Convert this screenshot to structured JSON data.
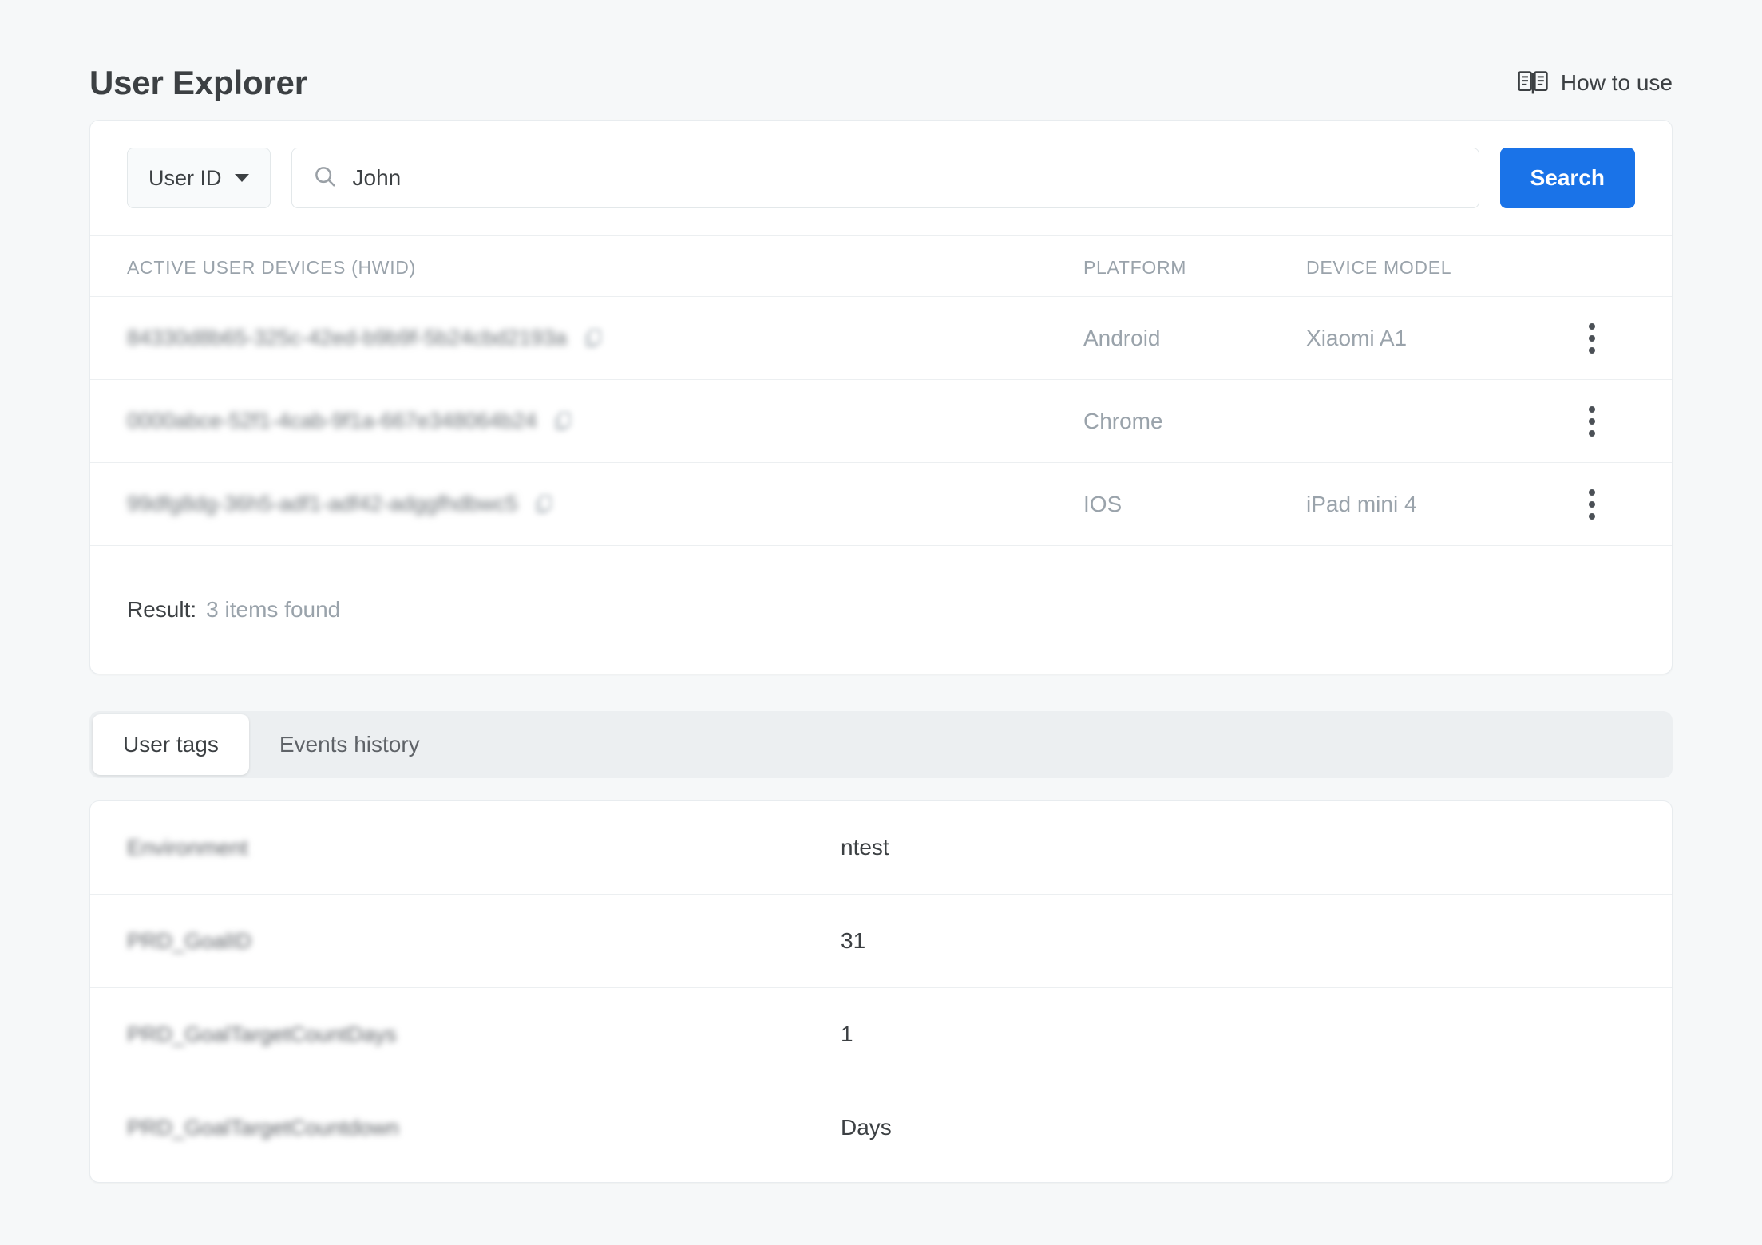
{
  "header": {
    "title": "User Explorer",
    "how_to_use_label": "How to use",
    "how_to_use_icon": "menu-book-icon"
  },
  "search": {
    "type_selector_label": "User ID",
    "query_value": "John",
    "query_placeholder": "",
    "search_button_label": "Search",
    "search_icon": "search-icon",
    "caret_icon": "chevron-down-icon",
    "accent_color": "#1a73e8"
  },
  "devices_table": {
    "columns": [
      "ACTIVE USER DEVICES (HWID)",
      "PLATFORM",
      "DEVICE MODEL"
    ],
    "rows": [
      {
        "hwid": "84330d8b65-325c-42ed-b9b9f-5b24cbd2193a",
        "hwid_redacted": true,
        "platform": "Android",
        "device_model": "Xiaomi A1",
        "copy_icon": "copy-icon",
        "menu_icon": "more-vert-icon"
      },
      {
        "hwid": "0000abce-52f1-4cab-9f1a-667e348064b24",
        "hwid_redacted": true,
        "platform": "Chrome",
        "device_model": "",
        "copy_icon": "copy-icon",
        "menu_icon": "more-vert-icon"
      },
      {
        "hwid": "99dfg8dg-36h5-adf1-adf42-adggfhdbwc5",
        "hwid_redacted": true,
        "platform": "IOS",
        "device_model": "iPad mini 4",
        "copy_icon": "copy-icon",
        "menu_icon": "more-vert-icon"
      }
    ],
    "result_label": "Result:",
    "result_value": "3 items found"
  },
  "tabs": [
    {
      "label": "User tags",
      "active": true
    },
    {
      "label": "Events history",
      "active": false
    }
  ],
  "user_tags": {
    "rows": [
      {
        "key": "Environment",
        "key_redacted": true,
        "value": "ntest"
      },
      {
        "key": "PRD_GoalID",
        "key_redacted": true,
        "value": "31"
      },
      {
        "key": "PRD_GoalTargetCountDays",
        "key_redacted": true,
        "value": "1"
      },
      {
        "key": "PRD_GoalTargetCountdown",
        "key_redacted": true,
        "value": "Days"
      }
    ]
  }
}
